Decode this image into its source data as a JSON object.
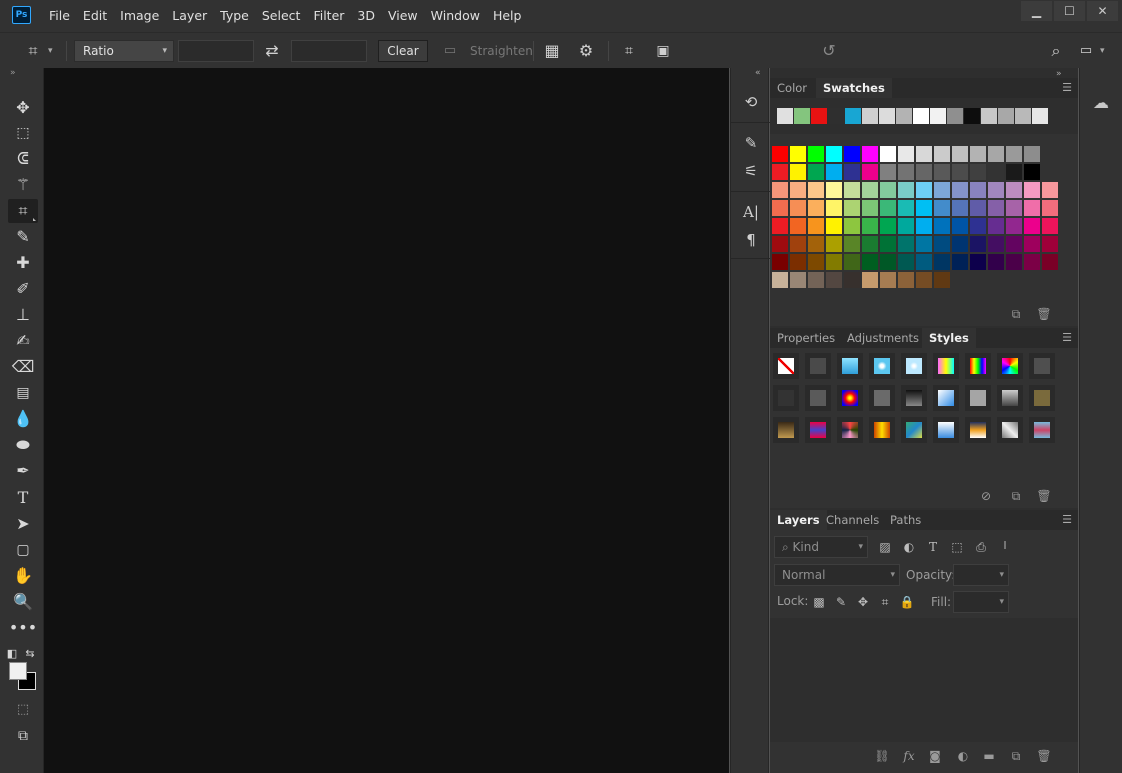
{
  "app": {
    "logo_text": "Ps"
  },
  "menu": [
    "File",
    "Edit",
    "Image",
    "Layer",
    "Type",
    "Select",
    "Filter",
    "3D",
    "View",
    "Window",
    "Help"
  ],
  "window_controls": {
    "minimize": "▁",
    "maximize": "☐",
    "close": "✕"
  },
  "options_bar": {
    "ratio_label": "Ratio",
    "width_value": "",
    "height_value": "",
    "clear_label": "Clear",
    "straighten_label": "Straighten"
  },
  "panels": {
    "color_tab": "Color",
    "swatches_tab": "Swatches",
    "properties_tab": "Properties",
    "adjustments_tab": "Adjustments",
    "styles_tab": "Styles",
    "layers_tab": "Layers",
    "channels_tab": "Channels",
    "paths_tab": "Paths"
  },
  "layers": {
    "kind_placeholder": "Kind",
    "blend_mode": "Normal",
    "opacity_label": "Opacity:",
    "opacity_value": "",
    "lock_label": "Lock:",
    "fill_label": "Fill:",
    "fill_value": ""
  },
  "colors": {
    "recent_swatches": [
      "#e0e0e0",
      "#84c57e",
      "#e81212",
      "#2f2f2f",
      "#18a6d3",
      "#d0d0d0",
      "#dcdcdc",
      "#b3b3b3",
      "#ffffff",
      "#f2f2f2",
      "#8f8f8f",
      "#0d0d0d",
      "#c8c8c8",
      "#a8a8a8",
      "#b9b9b9",
      "#e6e6e6"
    ],
    "swatch_rows": [
      [
        "#fe0000",
        "#ffff00",
        "#00ff00",
        "#00ffff",
        "#0000ff",
        "#ff00ff",
        "#ffffff",
        "#e8e8e8",
        "#d8d8d8",
        "#cbcbcb",
        "#bfbfbf",
        "#b3b3b3",
        "#a7a7a7",
        "#9a9a9a",
        "#8d8d8d"
      ],
      [
        "#ee1c24",
        "#fff200",
        "#00a650",
        "#00aeef",
        "#2e3192",
        "#ec008c",
        "#808080",
        "#737373",
        "#666666",
        "#595959",
        "#4c4c4c",
        "#404040",
        "#333333",
        "#1a1a1a",
        "#000000"
      ],
      [
        "#f7977a",
        "#f9ad81",
        "#fdc68a",
        "#fff79a",
        "#c4df9b",
        "#a3d39c",
        "#82ca9d",
        "#7accc8",
        "#6dcff6",
        "#7da7d8",
        "#8493ca",
        "#8882be",
        "#a187be",
        "#bc8dbf",
        "#f49ac2",
        "#f6989d"
      ],
      [
        "#f26c4f",
        "#f68e55",
        "#fbaf5c",
        "#fff467",
        "#acd372",
        "#7cc576",
        "#3bb878",
        "#1abbb4",
        "#00bff3",
        "#438ccb",
        "#5574b9",
        "#605ca8",
        "#8560a8",
        "#a763a8",
        "#f06ea9",
        "#f26d7d"
      ],
      [
        "#ed1c24",
        "#f26522",
        "#f7941d",
        "#fff200",
        "#8dc63f",
        "#39b54a",
        "#00a651",
        "#00a99d",
        "#00aeef",
        "#0072bc",
        "#0054a6",
        "#2e3192",
        "#662d91",
        "#92278f",
        "#ec008c",
        "#ed145b"
      ],
      [
        "#9e0b0f",
        "#a0410d",
        "#a3620a",
        "#aba000",
        "#598527",
        "#1a7b30",
        "#007236",
        "#00746b",
        "#0076a3",
        "#004b80",
        "#003471",
        "#1b1464",
        "#440e62",
        "#630460",
        "#9e005d",
        "#9e0039"
      ],
      [
        "#790000",
        "#7b2e00",
        "#7d4900",
        "#827b00",
        "#406618",
        "#005e20",
        "#005826",
        "#005952",
        "#005b7f",
        "#003663",
        "#002157",
        "#0d004c",
        "#32004b",
        "#4b0049",
        "#7b0046",
        "#7a0026"
      ],
      [
        "#c7b299",
        "#998675",
        "#736357",
        "#534741",
        "#37302d",
        "#c69c6d",
        "#a67c52",
        "#8c6239",
        "#754c24",
        "#603913"
      ]
    ],
    "styles": [
      [
        "none",
        "#4a4a4a",
        "linear-gradient(#8fe3ff,#2f9ed8)",
        "radial-gradient(#fff 15%,#5cc7f0 40%)",
        "radial-gradient(#fff 10%,#bde9ff 35%)",
        "linear-gradient(90deg,#f6f,#ff0,#0ff)",
        "linear-gradient(90deg,#f00,#ff0,#0f0,#00f,#f0f)",
        "conic-gradient(#f00,#ff0,#0f0,#0ff,#00f,#f0f,#f00)",
        "#4f4f4f"
      ],
      [
        "#333333",
        "#5a5a5a",
        "radial-gradient(#ff0 10%,#f00 40%,#00f 80%)",
        "#6a6a6a",
        "linear-gradient(#111,#888)",
        "linear-gradient(135deg,#fff,#2e8be6)",
        "#a5a5a5",
        "linear-gradient(#ccc,#444)",
        "#7a6a3c"
      ],
      [
        "linear-gradient(#3a2a16,#c09a50)",
        "linear-gradient(#e04,#44c,#e04)",
        "conic-gradient(#f44,#240,#f9c,#124,#f44)",
        "linear-gradient(90deg,#c40,#fd0,#c40)",
        "linear-gradient(135deg,#3a7,#28c,#dd4)",
        "linear-gradient(#fff,#3a8ce0)",
        "linear-gradient(#203060,#f0a020,#fff)",
        "linear-gradient(45deg,#777,#eee,#777)",
        "linear-gradient(#7bd,#c46,#7bd)"
      ]
    ]
  }
}
